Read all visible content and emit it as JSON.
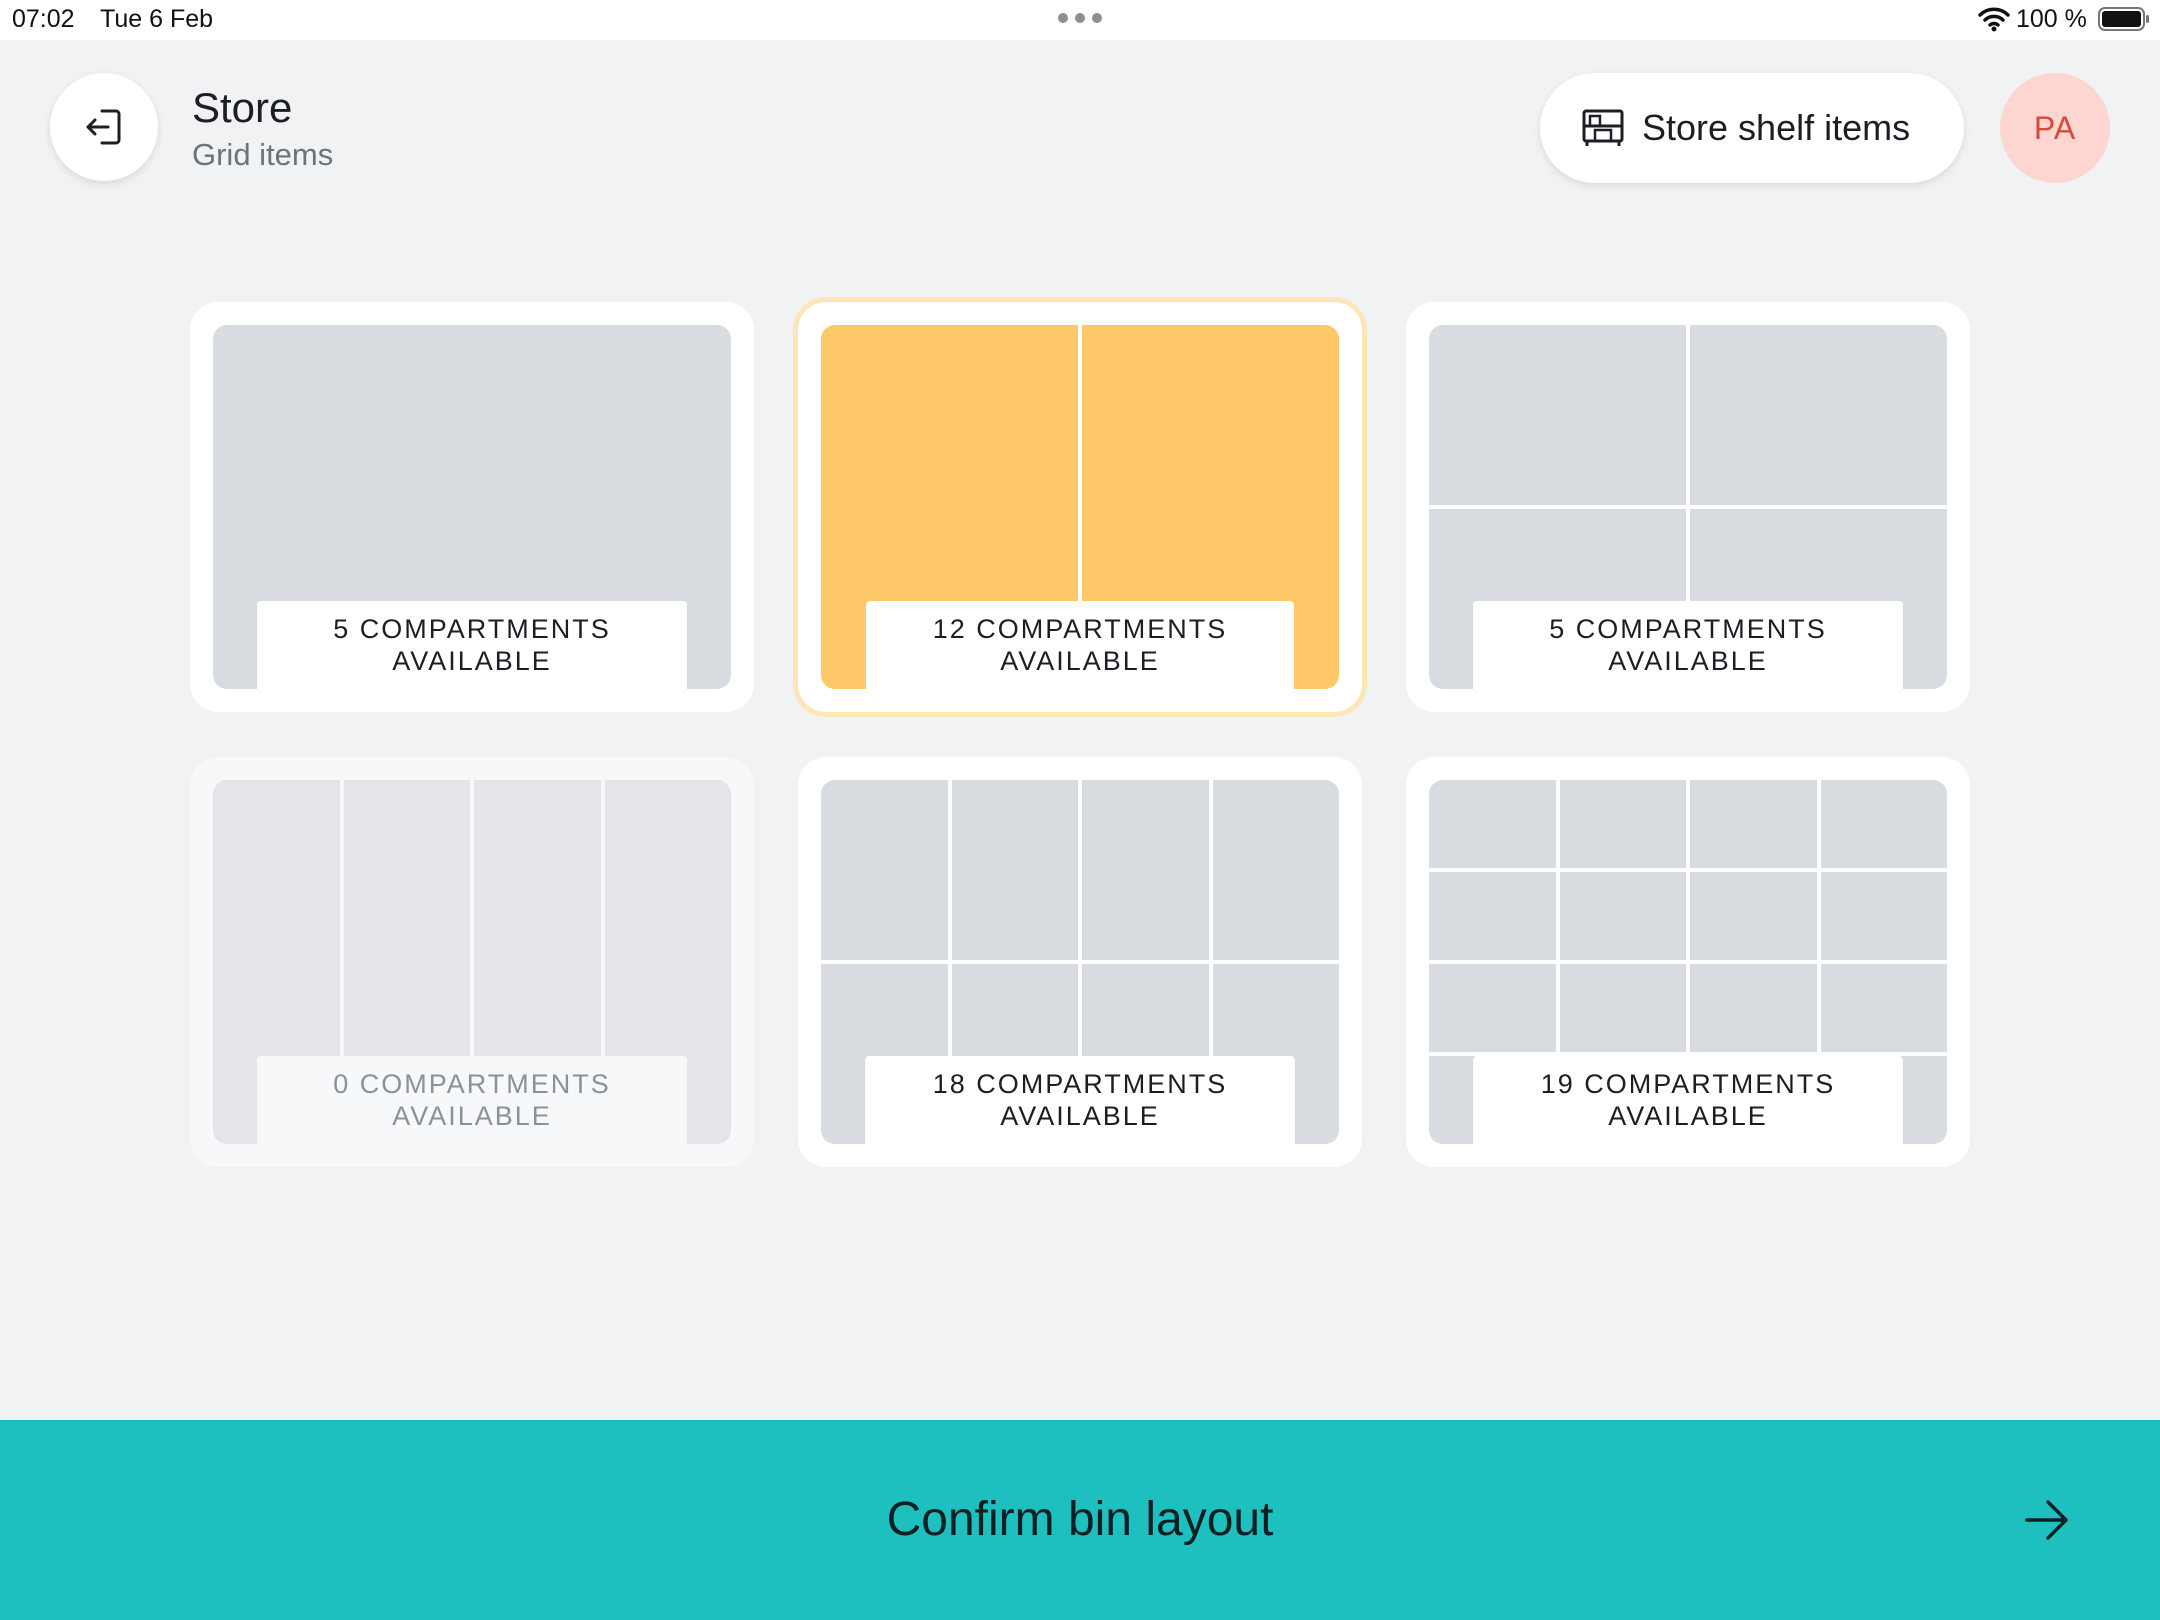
{
  "status_bar": {
    "time": "07:02",
    "date": "Tue 6 Feb",
    "battery": "100 %"
  },
  "header": {
    "title": "Store",
    "subtitle": "Grid items",
    "shelf_button_label": "Store shelf items",
    "avatar_initials": "PA"
  },
  "layouts": [
    {
      "count_line1": "5 COMPARTMENTS",
      "count_line2": "AVAILABLE",
      "columns": 1,
      "rows": 1,
      "selected": false,
      "disabled": false
    },
    {
      "count_line1": "12 COMPARTMENTS",
      "count_line2": "AVAILABLE",
      "columns": 2,
      "rows": 1,
      "selected": true,
      "disabled": false
    },
    {
      "count_line1": "5 COMPARTMENTS",
      "count_line2": "AVAILABLE",
      "columns": 2,
      "rows": 2,
      "selected": false,
      "disabled": false
    },
    {
      "count_line1": "0 COMPARTMENTS",
      "count_line2": "AVAILABLE",
      "columns": 4,
      "rows": 1,
      "selected": false,
      "disabled": true
    },
    {
      "count_line1": "18 COMPARTMENTS",
      "count_line2": "AVAILABLE",
      "columns": 4,
      "rows": 2,
      "selected": false,
      "disabled": false
    },
    {
      "count_line1": "19 COMPARTMENTS",
      "count_line2": "AVAILABLE",
      "columns": 4,
      "rows": 4,
      "selected": false,
      "disabled": false
    }
  ],
  "footer": {
    "confirm_label": "Confirm bin layout"
  },
  "colors": {
    "accent_teal": "#1ec0bf",
    "selected_amber": "#fec767",
    "avatar_bg": "#fdd6d1",
    "avatar_text": "#d84a35"
  },
  "icons": {
    "back": "logout-arrow-icon",
    "shelf": "shelf-icon",
    "confirm": "arrow-right-icon"
  }
}
